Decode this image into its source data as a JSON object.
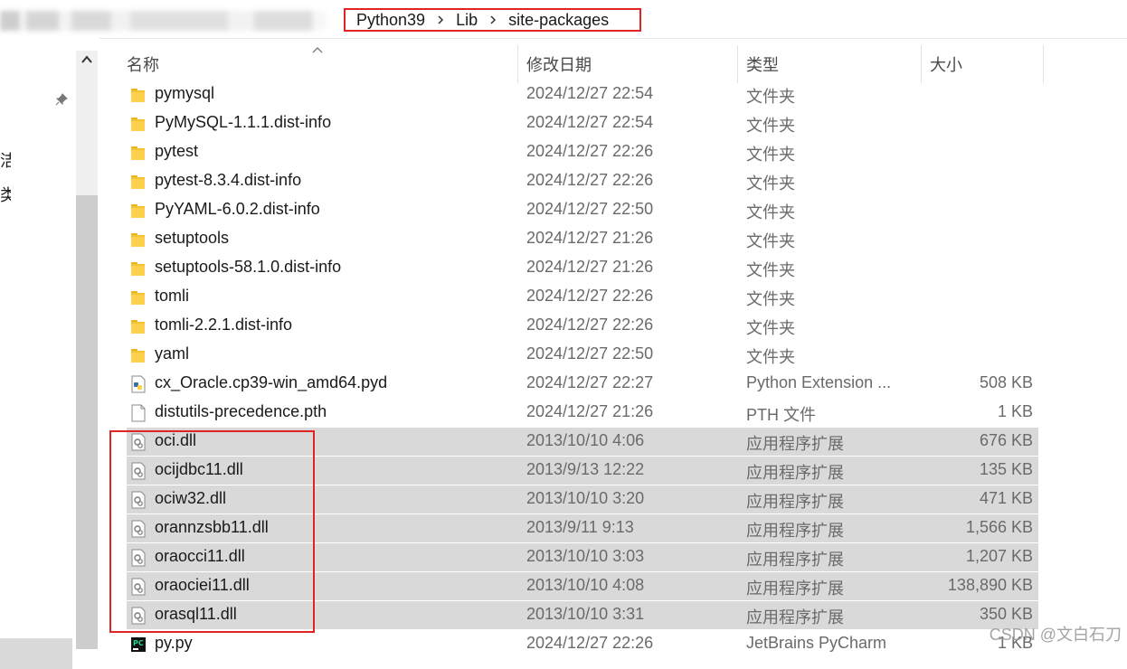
{
  "address_bar": {
    "breadcrumbs": [
      "Python39",
      "Lib",
      "site-packages"
    ]
  },
  "columns": {
    "name": "名称",
    "date": "修改日期",
    "type": "类型",
    "size": "大小"
  },
  "nav_pane": {
    "partial_items": [
      "洁",
      "类"
    ]
  },
  "files": [
    {
      "name": "pymysql",
      "date": "2024/12/27 22:54",
      "type": "文件夹",
      "size": "",
      "icon": "folder-icon",
      "selected": false
    },
    {
      "name": "PyMySQL-1.1.1.dist-info",
      "date": "2024/12/27 22:54",
      "type": "文件夹",
      "size": "",
      "icon": "folder-icon",
      "selected": false
    },
    {
      "name": "pytest",
      "date": "2024/12/27 22:26",
      "type": "文件夹",
      "size": "",
      "icon": "folder-icon",
      "selected": false
    },
    {
      "name": "pytest-8.3.4.dist-info",
      "date": "2024/12/27 22:26",
      "type": "文件夹",
      "size": "",
      "icon": "folder-icon",
      "selected": false
    },
    {
      "name": "PyYAML-6.0.2.dist-info",
      "date": "2024/12/27 22:50",
      "type": "文件夹",
      "size": "",
      "icon": "folder-icon",
      "selected": false
    },
    {
      "name": "setuptools",
      "date": "2024/12/27 21:26",
      "type": "文件夹",
      "size": "",
      "icon": "folder-icon",
      "selected": false
    },
    {
      "name": "setuptools-58.1.0.dist-info",
      "date": "2024/12/27 21:26",
      "type": "文件夹",
      "size": "",
      "icon": "folder-icon",
      "selected": false
    },
    {
      "name": "tomli",
      "date": "2024/12/27 22:26",
      "type": "文件夹",
      "size": "",
      "icon": "folder-icon",
      "selected": false
    },
    {
      "name": "tomli-2.2.1.dist-info",
      "date": "2024/12/27 22:26",
      "type": "文件夹",
      "size": "",
      "icon": "folder-icon",
      "selected": false
    },
    {
      "name": "yaml",
      "date": "2024/12/27 22:50",
      "type": "文件夹",
      "size": "",
      "icon": "folder-icon",
      "selected": false
    },
    {
      "name": "cx_Oracle.cp39-win_amd64.pyd",
      "date": "2024/12/27 22:27",
      "type": "Python Extension ...",
      "size": "508 KB",
      "icon": "python-file-icon",
      "selected": false
    },
    {
      "name": "distutils-precedence.pth",
      "date": "2024/12/27 21:26",
      "type": "PTH 文件",
      "size": "1 KB",
      "icon": "blank-file-icon",
      "selected": false
    },
    {
      "name": "oci.dll",
      "date": "2013/10/10 4:06",
      "type": "应用程序扩展",
      "size": "676 KB",
      "icon": "dll-file-icon",
      "selected": true
    },
    {
      "name": "ocijdbc11.dll",
      "date": "2013/9/13 12:22",
      "type": "应用程序扩展",
      "size": "135 KB",
      "icon": "dll-file-icon",
      "selected": true
    },
    {
      "name": "ociw32.dll",
      "date": "2013/10/10 3:20",
      "type": "应用程序扩展",
      "size": "471 KB",
      "icon": "dll-file-icon",
      "selected": true
    },
    {
      "name": "orannzsbb11.dll",
      "date": "2013/9/11 9:13",
      "type": "应用程序扩展",
      "size": "1,566 KB",
      "icon": "dll-file-icon",
      "selected": true
    },
    {
      "name": "oraocci11.dll",
      "date": "2013/10/10 3:03",
      "type": "应用程序扩展",
      "size": "1,207 KB",
      "icon": "dll-file-icon",
      "selected": true
    },
    {
      "name": "oraociei11.dll",
      "date": "2013/10/10 4:08",
      "type": "应用程序扩展",
      "size": "138,890 KB",
      "icon": "dll-file-icon",
      "selected": true
    },
    {
      "name": "orasql11.dll",
      "date": "2013/10/10 3:31",
      "type": "应用程序扩展",
      "size": "350 KB",
      "icon": "dll-file-icon",
      "selected": true
    },
    {
      "name": "py.py",
      "date": "2024/12/27 22:26",
      "type": "JetBrains PyCharm",
      "size": "1 KB",
      "icon": "pycharm-file-icon",
      "selected": false
    }
  ],
  "watermark": "CSDN @文白石刀",
  "colors": {
    "highlight_box": "#e02424",
    "selection": "#d9d9d9",
    "folder": "#f4c430"
  }
}
